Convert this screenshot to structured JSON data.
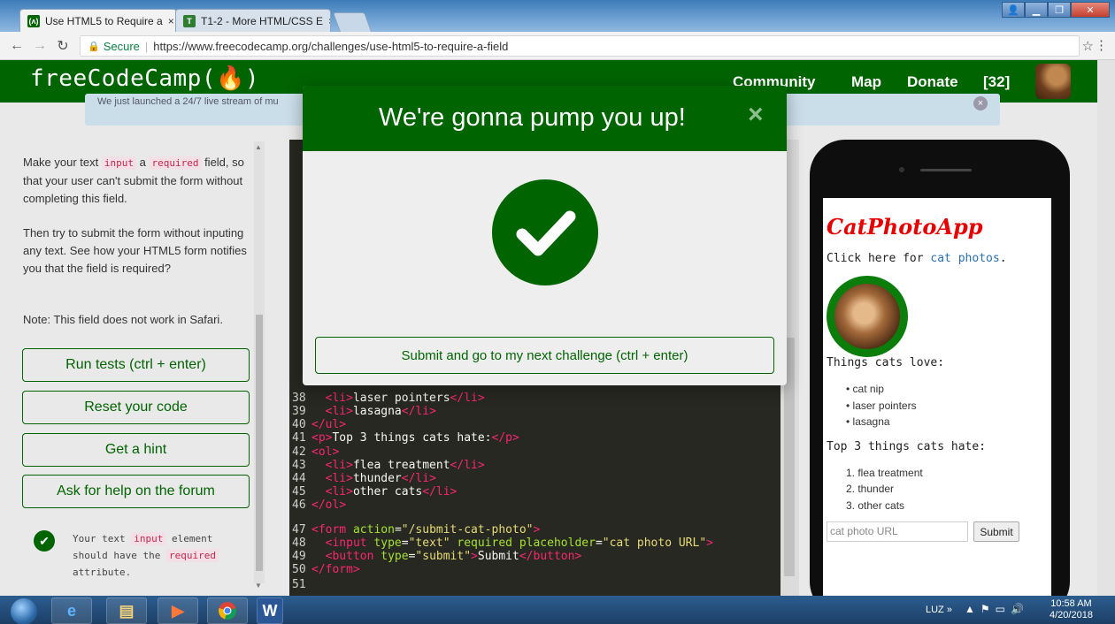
{
  "browser": {
    "tabs": [
      {
        "favicon": "(ʌ)",
        "title": "Use HTML5 to Require a",
        "active": true
      },
      {
        "favicon": "T",
        "title": "T1-2 - More HTML/CSS E",
        "active": false
      }
    ],
    "tab_close": "×",
    "secure_label": "Secure",
    "url": "https://www.freecodecamp.org/challenges/use-html5-to-require-a-field"
  },
  "nav": {
    "logo": "freeCodeCamp(🔥)",
    "links": [
      "Community",
      "Map",
      "Donate",
      "[32]"
    ]
  },
  "banner": {
    "text": "We just launched a 24/7 live stream of mu"
  },
  "instructions": {
    "p1_a": "Make your text ",
    "p1_code1": "input",
    "p1_b": " a ",
    "p1_code2": "required",
    "p1_c": " field, so that your user can't submit the form without completing this field.",
    "p2": "Then try to submit the form without inputing any text. See how your HTML5 form notifies you that the field is required?",
    "p3": "Note: This field does not work in Safari."
  },
  "buttons": {
    "run": "Run tests (ctrl + enter)",
    "reset": "Reset your code",
    "hint": "Get a hint",
    "help": "Ask for help on the forum"
  },
  "test": {
    "a": "Your text ",
    "code1": "input",
    "b": " element should have the ",
    "code2": "required",
    "c": " attribute."
  },
  "code": {
    "lines": [
      {
        "n": "38",
        "indent": "  ",
        "tag1": "<li>",
        "text": "laser pointers",
        "tag2": "</li>"
      },
      {
        "n": "39",
        "indent": "  ",
        "tag1": "<li>",
        "text": "lasagna",
        "tag2": "</li>"
      },
      {
        "n": "40",
        "indent": "",
        "tag1": "</ul>",
        "text": "",
        "tag2": ""
      },
      {
        "n": "41",
        "indent": "",
        "tag1": "<p>",
        "text": "Top 3 things cats hate:",
        "tag2": "</p>"
      },
      {
        "n": "42",
        "indent": "",
        "tag1": "<ol>",
        "text": "",
        "tag2": ""
      },
      {
        "n": "43",
        "indent": "  ",
        "tag1": "<li>",
        "text": "flea treatment",
        "tag2": "</li>"
      },
      {
        "n": "44",
        "indent": "  ",
        "tag1": "<li>",
        "text": "thunder",
        "tag2": "</li>"
      },
      {
        "n": "45",
        "indent": "  ",
        "tag1": "<li>",
        "text": "other cats",
        "tag2": "</li>"
      },
      {
        "n": "46",
        "indent": "",
        "tag1": "</ol>",
        "text": "",
        "tag2": ""
      }
    ],
    "l47": {
      "n": "47",
      "t": "<form ",
      "a": "action",
      "eq": "=",
      "v": "\"/submit-cat-photo\"",
      "e": ">"
    },
    "l48": {
      "n": "48",
      "t": "  <input ",
      "a1": "type",
      "v1": "\"text\"",
      "a2": " required placeholder",
      "v2": "\"cat photo URL\"",
      "e": ">"
    },
    "l49": {
      "n": "49",
      "t": "  <button ",
      "a": "type",
      "v": "\"submit\"",
      "e": ">",
      "text": "Submit",
      "close": "</button>"
    },
    "l50": {
      "n": "50",
      "t": "</form>"
    },
    "l51": {
      "n": "51"
    }
  },
  "preview": {
    "title": "CatPhotoApp",
    "click_a": "Click here for ",
    "click_link": "cat photos",
    "click_b": ".",
    "love_heading": "Things cats love:",
    "love": [
      "cat nip",
      "laser pointers",
      "lasagna"
    ],
    "hate_heading": "Top 3 things cats hate:",
    "hate": [
      "1. flea treatment",
      "2. thunder",
      "3. other cats"
    ],
    "input_placeholder": "cat photo URL",
    "submit": "Submit"
  },
  "modal": {
    "title": "We're gonna pump you up!",
    "close": "×",
    "submit": "Submit and go to my next challenge (ctrl + enter)"
  },
  "taskbar": {
    "lang": "LUZ",
    "expand": "»",
    "time": "10:58 AM",
    "date": "4/20/2018"
  },
  "colors": {
    "fcc_green": "#006400",
    "code_bg": "#272822",
    "tag_pink": "#f92672",
    "attr_green": "#a6e22e",
    "string_yellow": "#e6db74"
  }
}
